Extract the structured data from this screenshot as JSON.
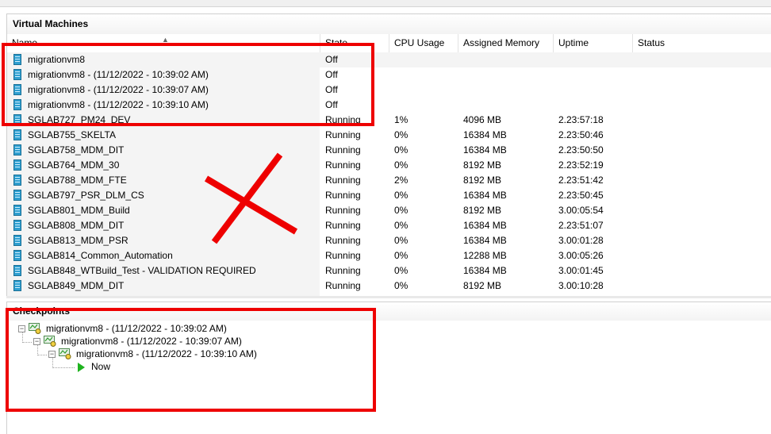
{
  "vm_panel": {
    "title": "Virtual Machines",
    "columns": [
      "Name",
      "State",
      "CPU Usage",
      "Assigned Memory",
      "Uptime",
      "Status"
    ],
    "rows": [
      {
        "name": "migrationvm8",
        "state": "Off",
        "cpu": "",
        "memory": "",
        "uptime": "",
        "status": ""
      },
      {
        "name": "migrationvm8 - (11/12/2022 - 10:39:02 AM)",
        "state": "Off",
        "cpu": "",
        "memory": "",
        "uptime": "",
        "status": ""
      },
      {
        "name": "migrationvm8 - (11/12/2022 - 10:39:07 AM)",
        "state": "Off",
        "cpu": "",
        "memory": "",
        "uptime": "",
        "status": ""
      },
      {
        "name": "migrationvm8 - (11/12/2022 - 10:39:10 AM)",
        "state": "Off",
        "cpu": "",
        "memory": "",
        "uptime": "",
        "status": ""
      },
      {
        "name": "SGLAB727_PM24_DEV",
        "state": "Running",
        "cpu": "1%",
        "memory": "4096 MB",
        "uptime": "2.23:57:18",
        "status": ""
      },
      {
        "name": "SGLAB755_SKELTA",
        "state": "Running",
        "cpu": "0%",
        "memory": "16384 MB",
        "uptime": "2.23:50:46",
        "status": ""
      },
      {
        "name": "SGLAB758_MDM_DIT",
        "state": "Running",
        "cpu": "0%",
        "memory": "16384 MB",
        "uptime": "2.23:50:50",
        "status": ""
      },
      {
        "name": "SGLAB764_MDM_30",
        "state": "Running",
        "cpu": "0%",
        "memory": "8192 MB",
        "uptime": "2.23:52:19",
        "status": ""
      },
      {
        "name": "SGLAB788_MDM_FTE",
        "state": "Running",
        "cpu": "2%",
        "memory": "8192 MB",
        "uptime": "2.23:51:42",
        "status": ""
      },
      {
        "name": "SGLAB797_PSR_DLM_CS",
        "state": "Running",
        "cpu": "0%",
        "memory": "16384 MB",
        "uptime": "2.23:50:45",
        "status": ""
      },
      {
        "name": "SGLAB801_MDM_Build",
        "state": "Running",
        "cpu": "0%",
        "memory": "8192 MB",
        "uptime": "3.00:05:54",
        "status": ""
      },
      {
        "name": "SGLAB808_MDM_DIT",
        "state": "Running",
        "cpu": "0%",
        "memory": "16384 MB",
        "uptime": "2.23:51:07",
        "status": ""
      },
      {
        "name": "SGLAB813_MDM_PSR",
        "state": "Running",
        "cpu": "0%",
        "memory": "16384 MB",
        "uptime": "3.00:01:28",
        "status": ""
      },
      {
        "name": "SGLAB814_Common_Automation",
        "state": "Running",
        "cpu": "0%",
        "memory": "12288 MB",
        "uptime": "3.00:05:26",
        "status": ""
      },
      {
        "name": "SGLAB848_WTBuild_Test - VALIDATION REQUIRED",
        "state": "Running",
        "cpu": "0%",
        "memory": "16384 MB",
        "uptime": "3.00:01:45",
        "status": ""
      },
      {
        "name": "SGLAB849_MDM_DIT",
        "state": "Running",
        "cpu": "0%",
        "memory": "8192 MB",
        "uptime": "3.00:10:28",
        "status": ""
      }
    ]
  },
  "checkpoints_panel": {
    "title": "Checkpoints",
    "nodes": [
      "migrationvm8 - (11/12/2022 - 10:39:02 AM)",
      "migrationvm8 - (11/12/2022 - 10:39:07 AM)",
      "migrationvm8 - (11/12/2022 - 10:39:10 AM)"
    ],
    "now_label": "Now"
  },
  "colors": {
    "annotation_red": "#ee0000",
    "vm_icon_blue": "#2f9fd0",
    "now_arrow_green": "#1fb31f"
  }
}
